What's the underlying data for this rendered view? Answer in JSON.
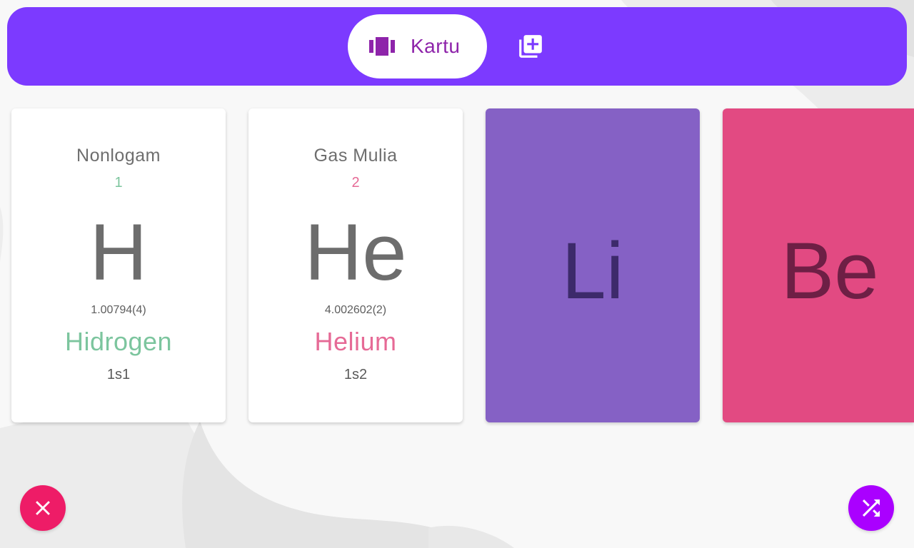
{
  "colors": {
    "topbar": "#7c3aff",
    "tab_active_text": "#8e24aa",
    "nonmetal": "#7cc59e",
    "noble_gas": "#e66a96",
    "li_card": "#8561c5",
    "li_symbol": "#3d2a6b",
    "be_card": "#e24a82",
    "be_symbol": "#6e1f45",
    "close_fab": "#ee1c67",
    "shuffle_fab": "#aa00ff"
  },
  "topbar": {
    "tab_cards": {
      "label": "Kartu",
      "icon": "view-carousel-icon"
    },
    "tab_add": {
      "icon": "library-add-icon"
    }
  },
  "cards": [
    {
      "category": "Nonlogam",
      "number": "1",
      "symbol": "H",
      "mass": "1.00794(4)",
      "name": "Hidrogen",
      "config": "1s1"
    },
    {
      "category": "Gas Mulia",
      "number": "2",
      "symbol": "He",
      "mass": "4.002602(2)",
      "name": "Helium",
      "config": "1s2"
    },
    {
      "symbol": "Li"
    },
    {
      "symbol": "Be"
    }
  ],
  "fabs": {
    "close": {
      "icon": "close-icon"
    },
    "shuffle": {
      "icon": "shuffle-icon"
    }
  }
}
